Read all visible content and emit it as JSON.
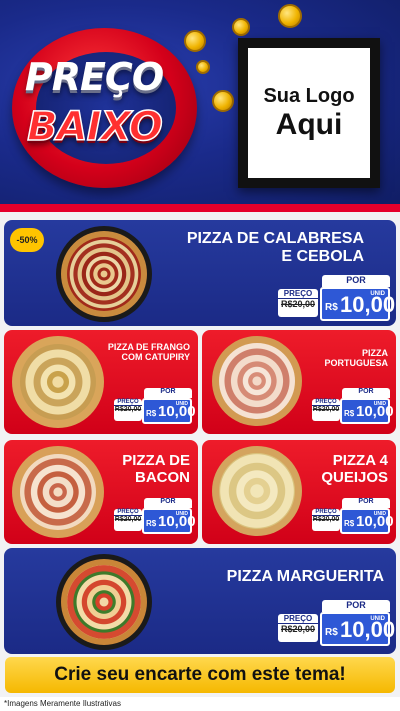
{
  "header": {
    "title_top": "PREÇO",
    "title_bottom": "BAIXO",
    "logo_line1": "Sua Logo",
    "logo_line2": "Aqui"
  },
  "featured": {
    "discount": "-50%",
    "name": "PIZZA DE CALABRESA E CEBOLA",
    "por": "POR",
    "old_label": "PREÇO",
    "old_value": "R$20,00",
    "currency": "R$",
    "price": "10,00",
    "unit": "UNID"
  },
  "items": [
    {
      "name": "PIZZA DE FRANGO COM CATUPIRY",
      "por": "POR",
      "old_label": "PREÇO",
      "old_value": "R$20,00",
      "currency": "R$",
      "price": "10,00",
      "unit": "UNID"
    },
    {
      "name": "PIZZA PORTUGUESA",
      "por": "POR",
      "old_label": "PREÇO",
      "old_value": "R$20,00",
      "currency": "R$",
      "price": "10,00",
      "unit": "UNID"
    },
    {
      "name": "PIZZA DE BACON",
      "por": "POR",
      "old_label": "PREÇO",
      "old_value": "R$20,00",
      "currency": "R$",
      "price": "10,00",
      "unit": "UNID"
    },
    {
      "name": "PIZZA 4 QUEIJOS",
      "por": "POR",
      "old_label": "PREÇO",
      "old_value": "R$20,00",
      "currency": "R$",
      "price": "10,00",
      "unit": "UNID"
    }
  ],
  "bottom_item": {
    "name": "PIZZA MARGUERITA",
    "por": "POR",
    "old_label": "PREÇO",
    "old_value": "R$20,00",
    "currency": "R$",
    "price": "10,00",
    "unit": "UNID"
  },
  "footer": {
    "banner": "Crie seu encarte com este tema!",
    "disclaimer": "*Imagens Meramente Ilustrativas"
  },
  "colors": {
    "brand_blue": "#1b2a86",
    "brand_red": "#e5002b",
    "price_blue": "#2e58d6",
    "accent_yellow": "#f5b800"
  }
}
